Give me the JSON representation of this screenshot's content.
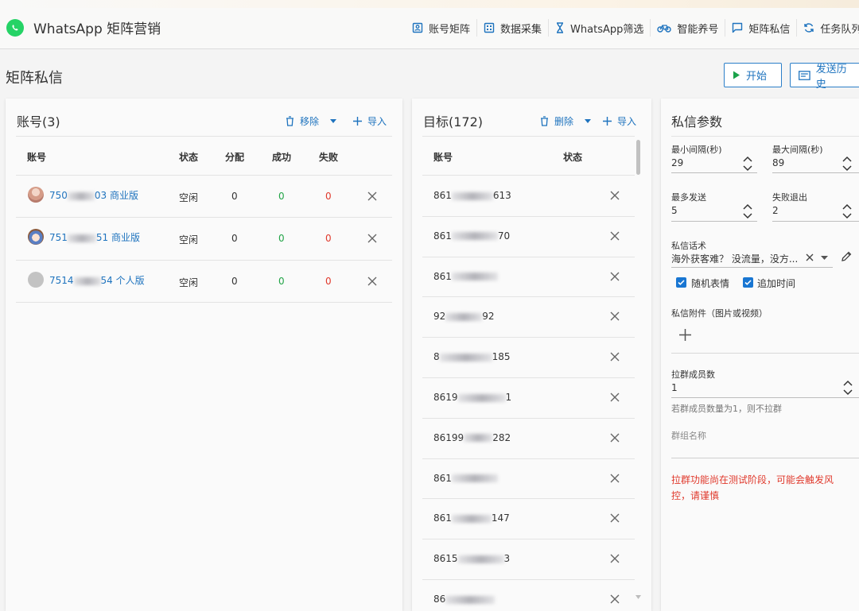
{
  "app": {
    "title": "WhatsApp 矩阵营销"
  },
  "nav": [
    {
      "label": "账号矩阵",
      "icon": "account-box-icon"
    },
    {
      "label": "数据采集",
      "icon": "grid-icon"
    },
    {
      "label": "WhatsApp筛选",
      "icon": "hourglass-icon"
    },
    {
      "label": "智能养号",
      "icon": "bike-icon"
    },
    {
      "label": "矩阵私信",
      "icon": "message-icon"
    },
    {
      "label": "任务队列",
      "icon": "sync-icon"
    }
  ],
  "page": {
    "title": "矩阵私信",
    "start_label": "开始",
    "history_label": "发送历史"
  },
  "accounts": {
    "title": "账号(3)",
    "remove_label": "移除",
    "import_label": "导入",
    "columns": [
      "账号",
      "状态",
      "分配",
      "成功",
      "失败"
    ],
    "rows": [
      {
        "prefix": "750",
        "suffix": "03 商业版",
        "status": "空闲",
        "assigned": "0",
        "success": "0",
        "failed": "0"
      },
      {
        "prefix": "751",
        "suffix": "51 商业版",
        "status": "空闲",
        "assigned": "0",
        "success": "0",
        "failed": "0"
      },
      {
        "prefix": "7514",
        "suffix": "54 个人版",
        "status": "空闲",
        "assigned": "0",
        "success": "0",
        "failed": "0"
      }
    ]
  },
  "targets": {
    "title": "目标(172)",
    "delete_label": "删除",
    "import_label": "导入",
    "columns": [
      "账号",
      "状态"
    ],
    "rows": [
      {
        "prefix": "861",
        "suffix": "613"
      },
      {
        "prefix": "861",
        "suffix": "70"
      },
      {
        "prefix": "861",
        "suffix": ""
      },
      {
        "prefix": "92",
        "suffix": "92"
      },
      {
        "prefix": "8",
        "suffix": "185"
      },
      {
        "prefix": "8619",
        "suffix": "1"
      },
      {
        "prefix": "86199",
        "suffix": "282"
      },
      {
        "prefix": "861",
        "suffix": ""
      },
      {
        "prefix": "861",
        "suffix": "147"
      },
      {
        "prefix": "8615",
        "suffix": "3"
      },
      {
        "prefix": "86",
        "suffix": ""
      }
    ]
  },
  "params": {
    "title": "私信参数",
    "min_interval_label": "最小间隔(秒)",
    "min_interval": "29",
    "max_interval_label": "最大间隔(秒)",
    "max_interval": "89",
    "max_send_label": "最多发送",
    "max_send": "5",
    "fail_exit_label": "失败退出",
    "fail_exit": "2",
    "script_label": "私信话术",
    "script_value": "海外获客难？ 没流量，没方...",
    "random_emoji_label": "随机表情",
    "append_time_label": "追加时间",
    "attachment_label": "私信附件（图片或视频）",
    "group_size_label": "拉群成员数",
    "group_size": "1",
    "group_hint": "若群成员数量为1，则不拉群",
    "group_name_placeholder": "群组名称",
    "warning": "拉群功能尚在测试阶段，可能会触发风控，请谨慎"
  }
}
